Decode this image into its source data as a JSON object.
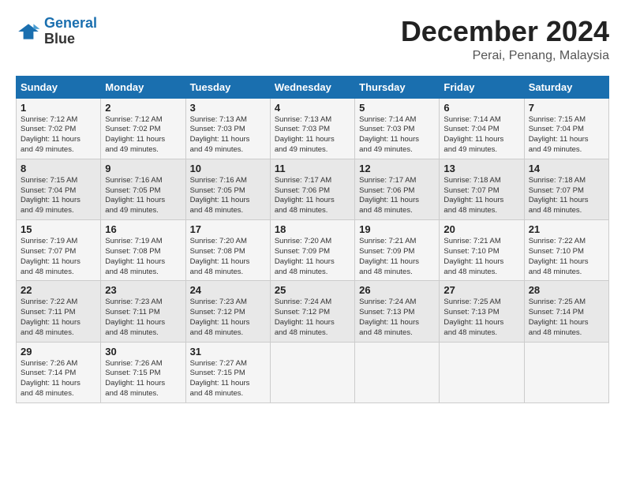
{
  "logo": {
    "line1": "General",
    "line2": "Blue"
  },
  "title": "December 2024",
  "location": "Perai, Penang, Malaysia",
  "days_of_week": [
    "Sunday",
    "Monday",
    "Tuesday",
    "Wednesday",
    "Thursday",
    "Friday",
    "Saturday"
  ],
  "weeks": [
    [
      {
        "day": 1,
        "rise": "7:12 AM",
        "set": "7:02 PM",
        "hours": "11",
        "mins": "49"
      },
      {
        "day": 2,
        "rise": "7:12 AM",
        "set": "7:02 PM",
        "hours": "11",
        "mins": "49"
      },
      {
        "day": 3,
        "rise": "7:13 AM",
        "set": "7:03 PM",
        "hours": "11",
        "mins": "49"
      },
      {
        "day": 4,
        "rise": "7:13 AM",
        "set": "7:03 PM",
        "hours": "11",
        "mins": "49"
      },
      {
        "day": 5,
        "rise": "7:14 AM",
        "set": "7:03 PM",
        "hours": "11",
        "mins": "49"
      },
      {
        "day": 6,
        "rise": "7:14 AM",
        "set": "7:04 PM",
        "hours": "11",
        "mins": "49"
      },
      {
        "day": 7,
        "rise": "7:15 AM",
        "set": "7:04 PM",
        "hours": "11",
        "mins": "49"
      }
    ],
    [
      {
        "day": 8,
        "rise": "7:15 AM",
        "set": "7:04 PM",
        "hours": "11",
        "mins": "49"
      },
      {
        "day": 9,
        "rise": "7:16 AM",
        "set": "7:05 PM",
        "hours": "11",
        "mins": "49"
      },
      {
        "day": 10,
        "rise": "7:16 AM",
        "set": "7:05 PM",
        "hours": "11",
        "mins": "48"
      },
      {
        "day": 11,
        "rise": "7:17 AM",
        "set": "7:06 PM",
        "hours": "11",
        "mins": "48"
      },
      {
        "day": 12,
        "rise": "7:17 AM",
        "set": "7:06 PM",
        "hours": "11",
        "mins": "48"
      },
      {
        "day": 13,
        "rise": "7:18 AM",
        "set": "7:07 PM",
        "hours": "11",
        "mins": "48"
      },
      {
        "day": 14,
        "rise": "7:18 AM",
        "set": "7:07 PM",
        "hours": "11",
        "mins": "48"
      }
    ],
    [
      {
        "day": 15,
        "rise": "7:19 AM",
        "set": "7:07 PM",
        "hours": "11",
        "mins": "48"
      },
      {
        "day": 16,
        "rise": "7:19 AM",
        "set": "7:08 PM",
        "hours": "11",
        "mins": "48"
      },
      {
        "day": 17,
        "rise": "7:20 AM",
        "set": "7:08 PM",
        "hours": "11",
        "mins": "48"
      },
      {
        "day": 18,
        "rise": "7:20 AM",
        "set": "7:09 PM",
        "hours": "11",
        "mins": "48"
      },
      {
        "day": 19,
        "rise": "7:21 AM",
        "set": "7:09 PM",
        "hours": "11",
        "mins": "48"
      },
      {
        "day": 20,
        "rise": "7:21 AM",
        "set": "7:10 PM",
        "hours": "11",
        "mins": "48"
      },
      {
        "day": 21,
        "rise": "7:22 AM",
        "set": "7:10 PM",
        "hours": "11",
        "mins": "48"
      }
    ],
    [
      {
        "day": 22,
        "rise": "7:22 AM",
        "set": "7:11 PM",
        "hours": "11",
        "mins": "48"
      },
      {
        "day": 23,
        "rise": "7:23 AM",
        "set": "7:11 PM",
        "hours": "11",
        "mins": "48"
      },
      {
        "day": 24,
        "rise": "7:23 AM",
        "set": "7:12 PM",
        "hours": "11",
        "mins": "48"
      },
      {
        "day": 25,
        "rise": "7:24 AM",
        "set": "7:12 PM",
        "hours": "11",
        "mins": "48"
      },
      {
        "day": 26,
        "rise": "7:24 AM",
        "set": "7:13 PM",
        "hours": "11",
        "mins": "48"
      },
      {
        "day": 27,
        "rise": "7:25 AM",
        "set": "7:13 PM",
        "hours": "11",
        "mins": "48"
      },
      {
        "day": 28,
        "rise": "7:25 AM",
        "set": "7:14 PM",
        "hours": "11",
        "mins": "48"
      }
    ],
    [
      {
        "day": 29,
        "rise": "7:26 AM",
        "set": "7:14 PM",
        "hours": "11",
        "mins": "48"
      },
      {
        "day": 30,
        "rise": "7:26 AM",
        "set": "7:15 PM",
        "hours": "11",
        "mins": "48"
      },
      {
        "day": 31,
        "rise": "7:27 AM",
        "set": "7:15 PM",
        "hours": "11",
        "mins": "48"
      },
      null,
      null,
      null,
      null
    ]
  ]
}
